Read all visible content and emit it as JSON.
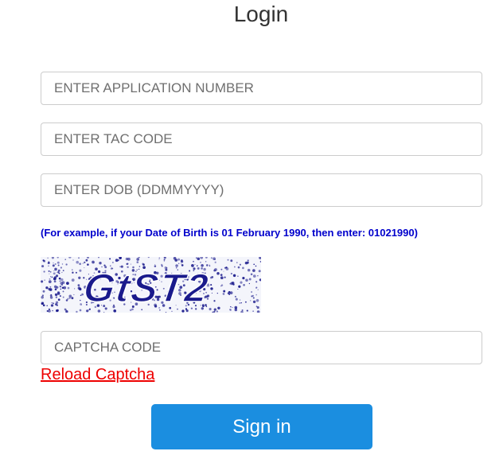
{
  "page": {
    "title": "Login"
  },
  "form": {
    "application_number_placeholder": "ENTER APPLICATION NUMBER",
    "tac_code_placeholder": "ENTER TAC CODE",
    "dob_placeholder": "ENTER DOB (DDMMYYYY)",
    "dob_hint": "(For example, if your Date of Birth is 01 February 1990, then enter: 01021990)",
    "captcha_text": "GtST2",
    "captcha_placeholder": "CAPTCHA CODE",
    "reload_captcha_label": "Reload Captcha",
    "sign_in_label": "Sign in"
  },
  "colors": {
    "accent_button": "#1b8ee0",
    "hint_text": "#0000cc",
    "reload_link": "#ee0000",
    "captcha_ink": "#1a1a8c"
  }
}
